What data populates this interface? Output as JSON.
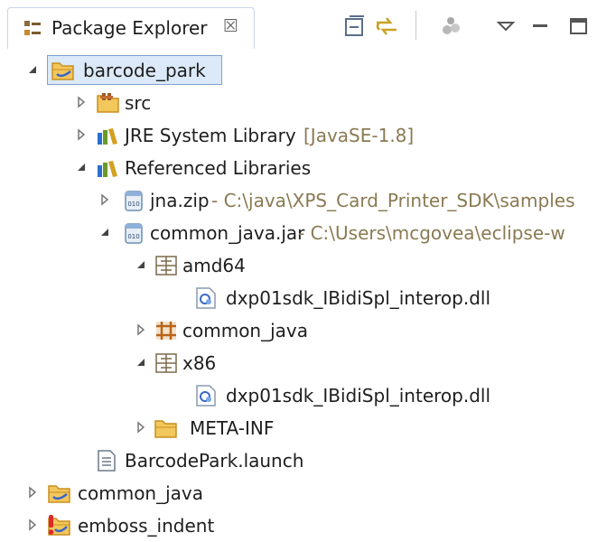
{
  "view": {
    "tab_title": "Package Explorer",
    "tab_close": "☒",
    "toolbar": [
      {
        "name": "collapse-all-icon",
        "icon": "collapse-all"
      },
      {
        "name": "link-with-editor-icon",
        "icon": "link-with-editor"
      },
      {
        "name": "focus-active-task-icon",
        "icon": "focus-active-task"
      },
      {
        "name": "view-menu-icon",
        "icon": "view-menu"
      },
      {
        "name": "minimize-icon",
        "icon": "minimize"
      },
      {
        "name": "maximize-icon",
        "icon": "maximize"
      }
    ]
  },
  "tree": {
    "barcode_park": "barcode_park",
    "src": "src",
    "jre_label": "JRE System Library",
    "jre_deco": "[JavaSE-1.8]",
    "referenced_libraries": "Referenced Libraries",
    "jna_label": "jna.zip",
    "jna_deco": " - C:\\java\\XPS_Card_Printer_SDK\\samples",
    "common_jar_label": "common_java.jar",
    "common_jar_deco": " - C:\\Users\\mcgovea\\eclipse-w",
    "amd64": "amd64",
    "dll_amd64": "dxp01sdk_IBidiSpl_interop.dll",
    "common_java_pkg": "common_java",
    "x86": "x86",
    "dll_x86": "dxp01sdk_IBidiSpl_interop.dll",
    "meta_inf": "META-INF",
    "launch_file": "BarcodePark.launch",
    "common_java_project": "common_java",
    "emboss_indent": "emboss_indent"
  },
  "colors": {
    "selection": "#dbe9f8",
    "decoration": "#8a7a52",
    "folder": "#f2c75c",
    "error": "#e02828"
  }
}
